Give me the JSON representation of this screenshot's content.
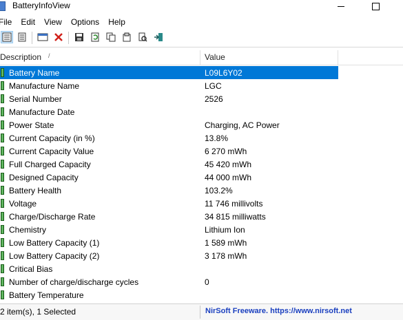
{
  "window": {
    "title": "BatteryInfoView"
  },
  "menu": [
    "File",
    "Edit",
    "View",
    "Options",
    "Help"
  ],
  "columns": {
    "description": "Description",
    "value": "Value"
  },
  "rows": [
    {
      "description": "Battery Name",
      "value": "L09L6Y02",
      "selected": true
    },
    {
      "description": "Manufacture Name",
      "value": "LGC"
    },
    {
      "description": "Serial Number",
      "value": " 2526"
    },
    {
      "description": "Manufacture Date",
      "value": ""
    },
    {
      "description": "Power State",
      "value": "Charging, AC Power"
    },
    {
      "description": "Current Capacity (in %)",
      "value": "13.8%"
    },
    {
      "description": "Current Capacity Value",
      "value": "6 270 mWh"
    },
    {
      "description": "Full Charged Capacity",
      "value": "45 420 mWh"
    },
    {
      "description": "Designed Capacity",
      "value": "44 000 mWh"
    },
    {
      "description": "Battery Health",
      "value": "103.2%"
    },
    {
      "description": "Voltage",
      "value": "11 746 millivolts"
    },
    {
      "description": "Charge/Discharge Rate",
      "value": "34 815 milliwatts"
    },
    {
      "description": "Chemistry",
      "value": "Lithium Ion"
    },
    {
      "description": "Low Battery Capacity (1)",
      "value": "1 589 mWh"
    },
    {
      "description": "Low Battery Capacity (2)",
      "value": "3 178 mWh"
    },
    {
      "description": "Critical Bias",
      "value": ""
    },
    {
      "description": "Number of charge/discharge cycles",
      "value": "0"
    },
    {
      "description": "Battery Temperature",
      "value": ""
    }
  ],
  "status": {
    "left": "2 item(s), 1 Selected",
    "link": "NirSoft Freeware. https://www.nirsoft.net"
  },
  "colors": {
    "selection": "#0078d7",
    "link": "#1a3fbf",
    "battery": "#2e8b2e"
  }
}
